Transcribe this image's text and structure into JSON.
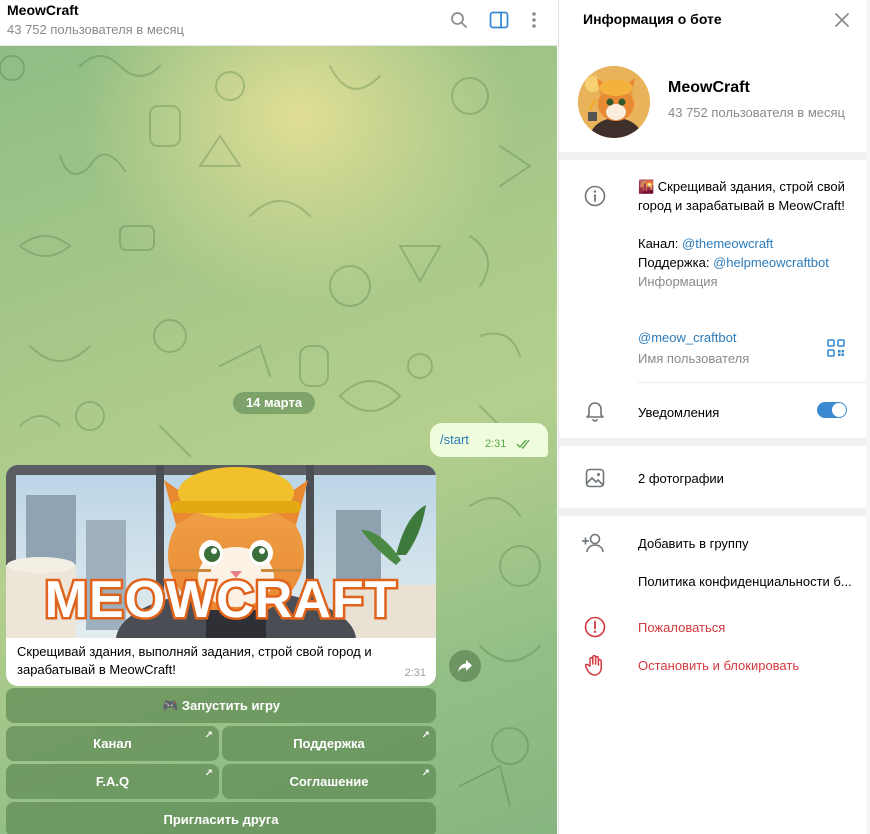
{
  "chat": {
    "title": "MeowCraft",
    "subtitle": "43 752 пользователя в месяц",
    "header_icons": [
      "search-icon",
      "sidebar-toggle-icon",
      "more-vertical-icon"
    ],
    "date_label": "14 марта",
    "outgoing": {
      "text": "/start",
      "time": "2:31"
    },
    "bot_message": {
      "banner_title": "MEOWCRAFT",
      "text": "Скрещивай здания, выполняй задания, строй свой город и зарабатывай в MeowCraft!",
      "time": "2:31"
    },
    "keyboard": {
      "play": "🎮 Запустить игру",
      "channel": "Канал",
      "support": "Поддержка",
      "faq": "F.A.Q",
      "agreement": "Соглашение",
      "invite": "Пригласить друга"
    }
  },
  "info_panel": {
    "title": "Информация о боте",
    "bot_name": "MeowCraft",
    "bot_sub": "43 752 пользователя в месяц",
    "description_line1": "🌇 Скрещивай здания, строй свой город и зарабатывай в MeowCraft!",
    "channel_label": "Канал:",
    "channel_link": "@themeowcraft",
    "support_label": "Поддержка:",
    "support_link": "@helpmeowcraftbot",
    "info_caption": "Информация",
    "username": "@meow_craftbot",
    "username_caption": "Имя пользователя",
    "notifications_label": "Уведомления",
    "notifications_on": true,
    "photos_label": "2 фотографии",
    "add_to_group": "Добавить в группу",
    "privacy_policy": "Политика конфиденциальности б...",
    "report": "Пожаловаться",
    "block": "Остановить и блокировать"
  },
  "colors": {
    "accent": "#2b7ab9",
    "toggle": "#3a8ad2",
    "danger": "#d2383f",
    "out_bubble": "#effdde",
    "keyboard_button": "#5f8a55"
  }
}
